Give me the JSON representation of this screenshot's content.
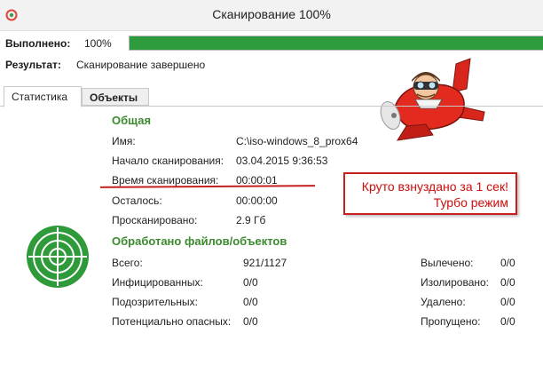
{
  "window": {
    "title": "Сканирование 100%"
  },
  "status": {
    "completed_label": "Выполнено:",
    "completed_value": "100%",
    "progress_fraction": 1.0,
    "result_label": "Результат:",
    "result_value": "Сканирование завершено"
  },
  "tabs": [
    {
      "label": "Статистика",
      "active": true
    },
    {
      "label": "Объекты",
      "active": false
    }
  ],
  "general": {
    "heading": "Общая",
    "rows": [
      {
        "label": "Имя:",
        "value": "C:\\iso-windows_8_prox64"
      },
      {
        "label": "Начало сканирования:",
        "value": "03.04.2015 9:36:53"
      },
      {
        "label": "Время сканирования:",
        "value": "00:00:01"
      },
      {
        "label": "Осталось:",
        "value": "00:00:00"
      },
      {
        "label": "Просканировано:",
        "value": "2.9 Гб"
      }
    ]
  },
  "processed": {
    "heading": "Обработано файлов/объектов",
    "left": [
      {
        "label": "Всего:",
        "value": "921/1127"
      },
      {
        "label": "Инфицированных:",
        "value": "0/0"
      },
      {
        "label": "Подозрительных:",
        "value": "0/0"
      },
      {
        "label": "Потенциально опасных:",
        "value": "0/0"
      }
    ],
    "right": [
      {
        "label": "Вылечено:",
        "value": "0/0"
      },
      {
        "label": "Изолировано:",
        "value": "0/0"
      },
      {
        "label": "Удалено:",
        "value": "0/0"
      },
      {
        "label": "Пропущено:",
        "value": "0/0"
      }
    ]
  },
  "annotation": {
    "text": "Круто взнуздано за 1 сек! Турбо режим",
    "color": "#d21414"
  },
  "colors": {
    "accent_green": "#2e9b3d",
    "heading_green": "#3b8a2e",
    "annotation_red": "#c81e1e"
  },
  "icons": {
    "app": "app-logo-icon",
    "plane": "cartoon-plane-pilot",
    "radar": "radar-icon"
  }
}
